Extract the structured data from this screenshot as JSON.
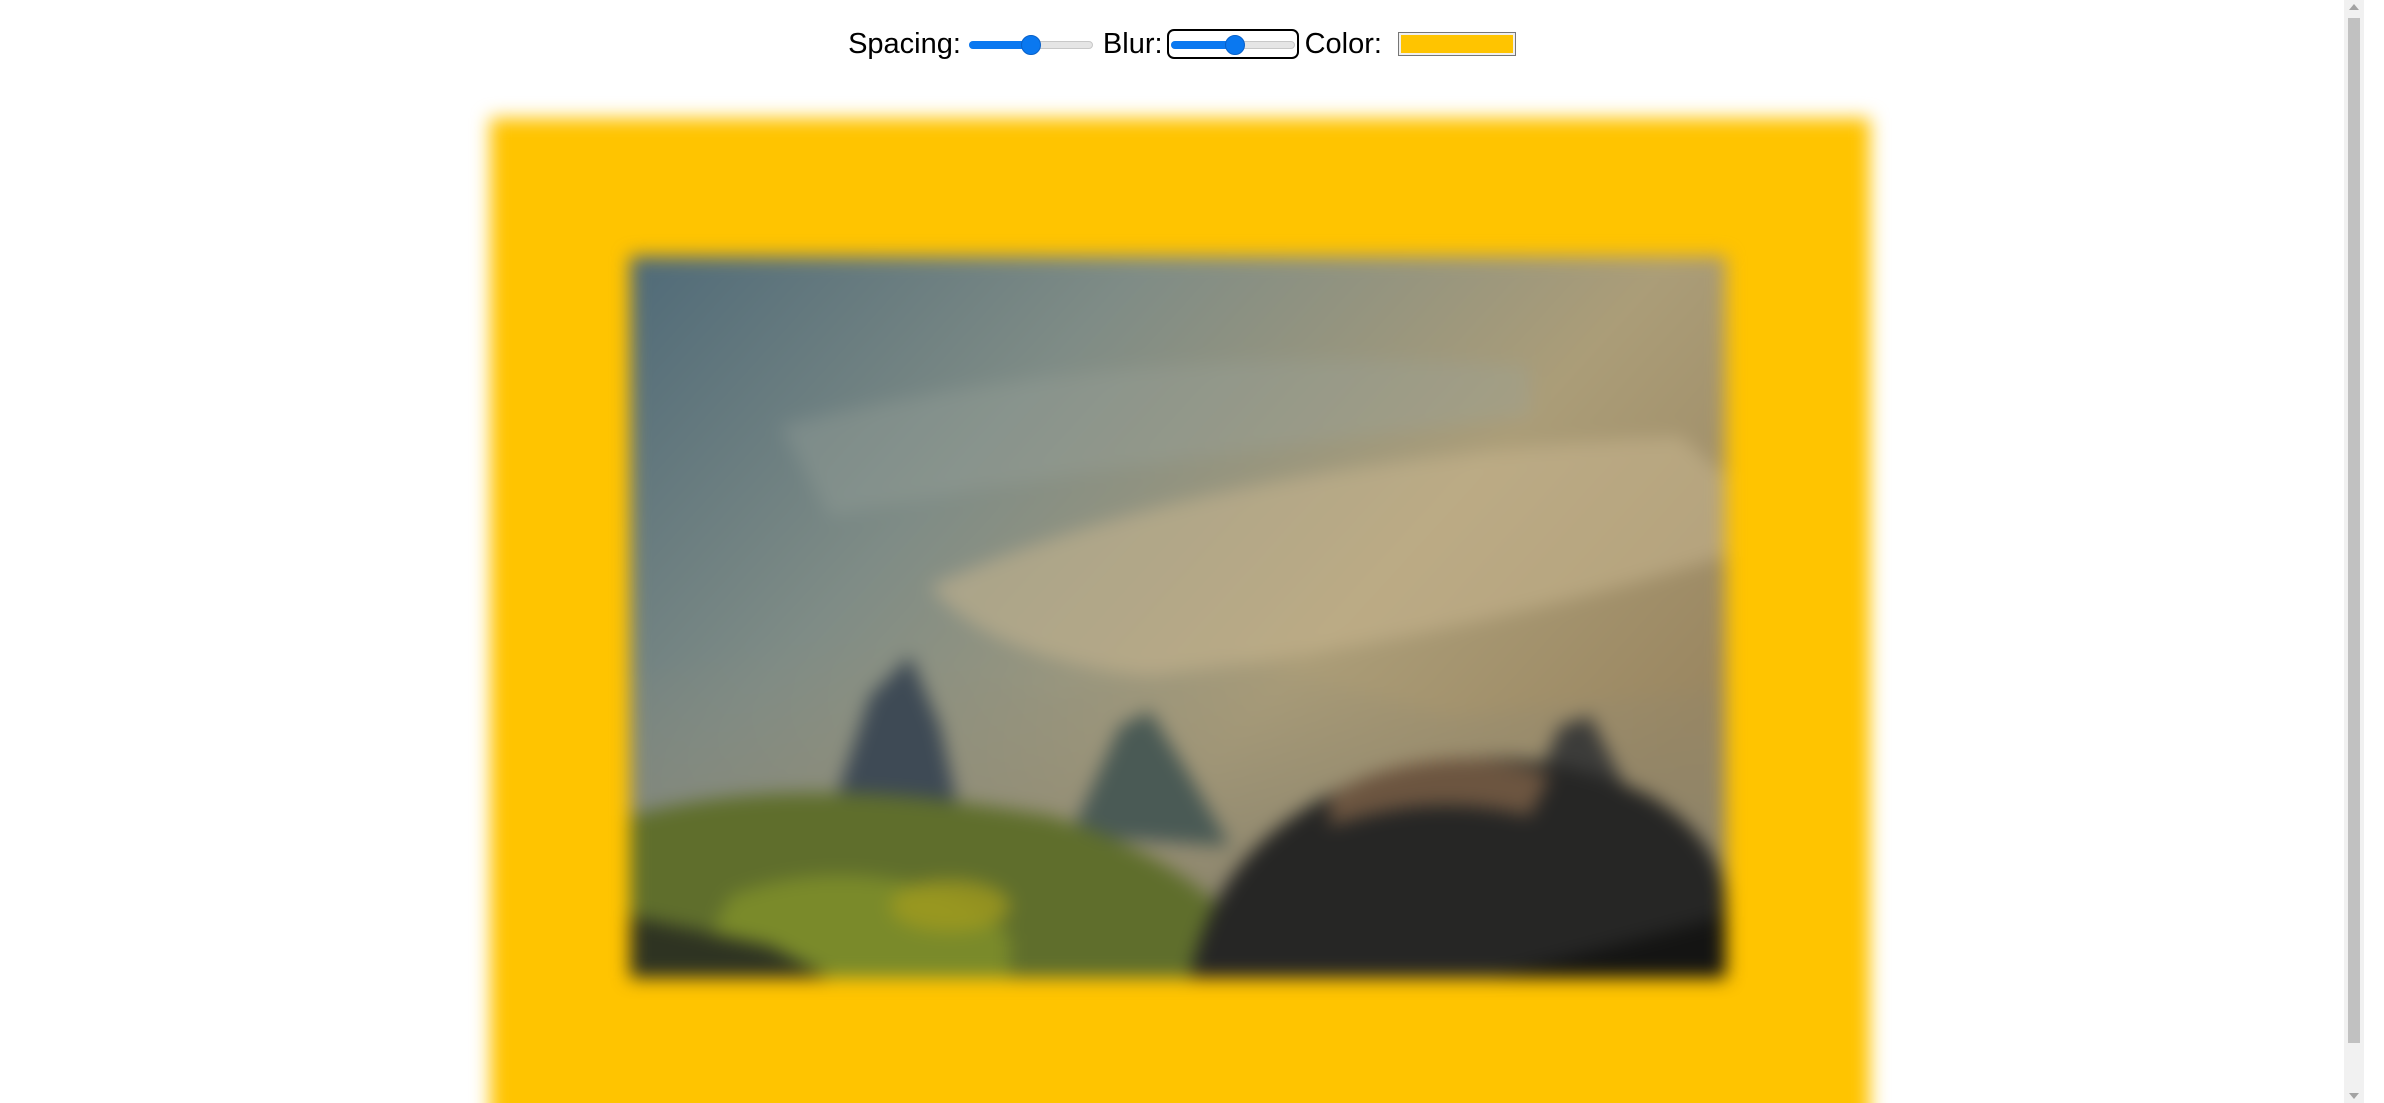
{
  "controls": {
    "spacing": {
      "label": "Spacing:",
      "value": 0.5
    },
    "blur": {
      "label": "Blur:",
      "value": 0.52
    },
    "color": {
      "label": "Color:",
      "value": "#ffc400"
    }
  },
  "frame": {
    "color": "#ffc400"
  },
  "photo": {
    "subject": "blurred mountain landscape with cloudy sky"
  },
  "scrollbar": {
    "position": 0.0
  }
}
